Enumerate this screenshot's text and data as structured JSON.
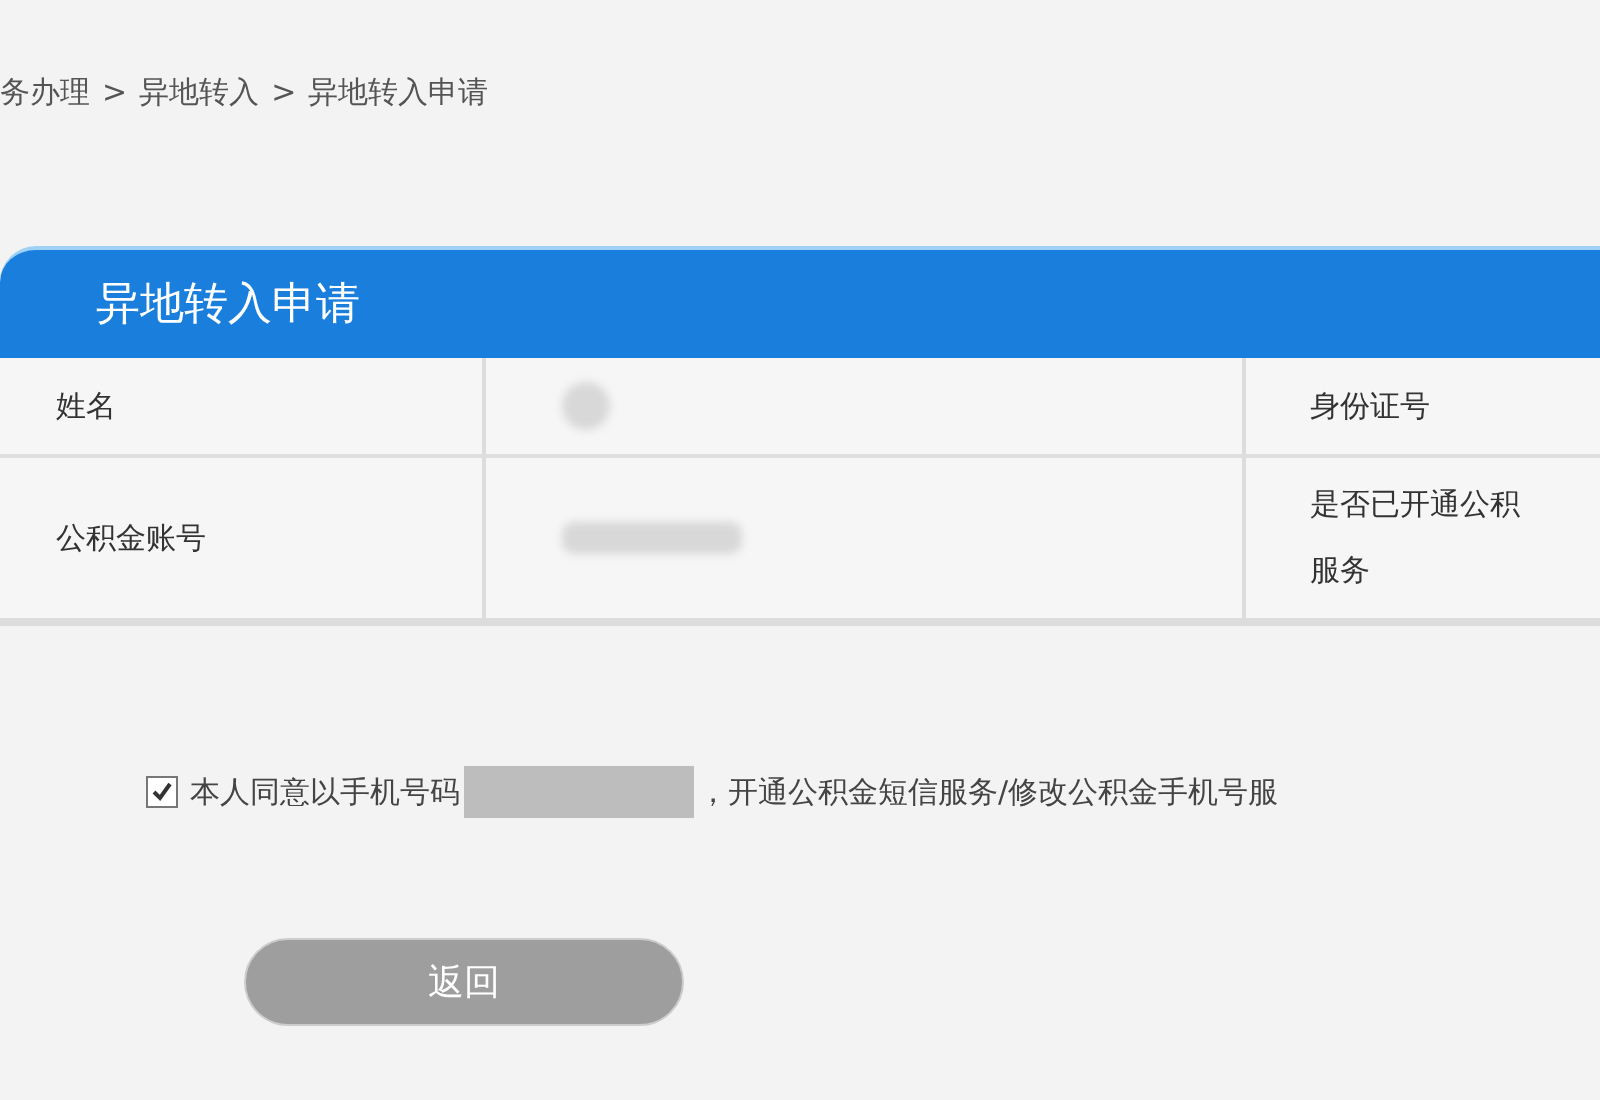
{
  "breadcrumb": [
    "务办理",
    "异地转入",
    "异地转入申请"
  ],
  "breadcrumb_separator": ">",
  "panel": {
    "title": "异地转入申请",
    "rows": [
      {
        "label": "姓名",
        "value_hidden": true,
        "label_2": [
          "身份证号"
        ]
      },
      {
        "label": "公积金账号",
        "value_hidden": true,
        "label_2": [
          "是否已开通公积",
          "服务"
        ]
      }
    ]
  },
  "consent": {
    "checked": true,
    "text_before": "本人同意以手机号码",
    "text_after": "，开通公积金短信服务/修改公积金手机号服"
  },
  "buttons": [
    {
      "label": "返回",
      "disabled": true
    }
  ]
}
